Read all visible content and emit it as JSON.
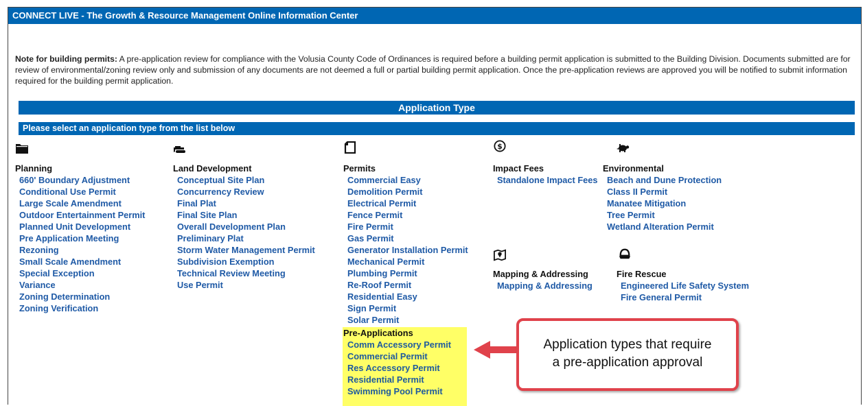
{
  "header": {
    "title": "CONNECT LIVE - The Growth & Resource Management Online Information Center"
  },
  "note": {
    "label": "Note for building permits:",
    "text": " A pre-application review for compliance with the Volusia County Code of Ordinances is required before a building permit application is submitted to the Building Division. Documents submitted are for review of environmental/zoning review only and submission of any documents are not deemed a full or partial building permit application. Once the pre-application reviews are approved you will be notified to submit information required for the building permit application."
  },
  "application_type": {
    "title": "Application Type",
    "instruction": "Please select an application type from the list below"
  },
  "categories": {
    "planning": {
      "icon": "folder-icon",
      "heading": "Planning",
      "items": [
        "660' Boundary Adjustment",
        "Conditional Use Permit",
        "Large Scale Amendment",
        "Outdoor Entertainment Permit",
        "Planned Unit Development",
        "Pre Application Meeting",
        "Rezoning",
        "Small Scale Amendment",
        "Special Exception",
        "Variance",
        "Zoning Determination",
        "Zoning Verification"
      ]
    },
    "land_development": {
      "icon": "bulldozer-icon",
      "heading": "Land Development",
      "items": [
        "Conceptual Site Plan",
        "Concurrency Review",
        "Final Plat",
        "Final Site Plan",
        "Overall Development Plan",
        "Preliminary Plat",
        "Storm Water Management Permit",
        "Subdivision Exemption",
        "Technical Review Meeting",
        "Use Permit"
      ]
    },
    "permits": {
      "icon": "document-icon",
      "heading": "Permits",
      "items": [
        "Commercial Easy",
        "Demolition Permit",
        "Electrical Permit",
        "Fence Permit",
        "Fire Permit",
        "Gas Permit",
        "Generator Installation Permit",
        "Mechanical Permit",
        "Plumbing Permit",
        "Re-Roof Permit",
        "Residential Easy",
        "Sign Permit",
        "Solar Permit"
      ]
    },
    "pre_applications": {
      "heading": "Pre-Applications",
      "items": [
        "Comm Accessory Permit",
        "Commercial Permit",
        "Res Accessory Permit",
        "Residential Permit",
        "Swimming Pool Permit"
      ]
    },
    "impact_fees": {
      "icon": "dollar-icon",
      "heading": "Impact Fees",
      "items": [
        "Standalone Impact Fees"
      ]
    },
    "environmental": {
      "icon": "turtle-icon",
      "heading": "Environmental",
      "items": [
        "Beach and Dune Protection",
        "Class II Permit",
        "Manatee Mitigation",
        "Tree Permit",
        "Wetland Alteration Permit"
      ]
    },
    "mapping": {
      "icon": "map-icon",
      "heading": "Mapping & Addressing",
      "items": [
        "Mapping & Addressing"
      ]
    },
    "fire_rescue": {
      "icon": "fire-helmet-icon",
      "heading": "Fire Rescue",
      "items": [
        "Engineered Life Safety System",
        "Fire General Permit"
      ]
    }
  },
  "callout": {
    "line1": "Application types that require",
    "line2": "a pre-application approval"
  },
  "colors": {
    "header_blue": "#0066b3",
    "link_blue": "#1f5aa6",
    "highlight_yellow": "#ffff66",
    "callout_red": "#e0424b"
  }
}
